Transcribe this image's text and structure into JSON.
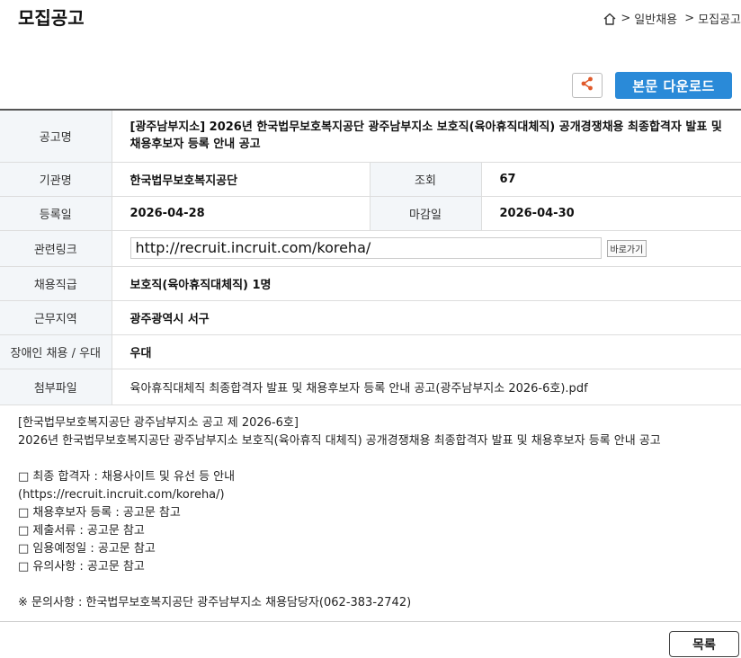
{
  "header": {
    "title": "모집공고",
    "breadcrumb": [
      "일반채용",
      "모집공고"
    ]
  },
  "toolbar": {
    "share_icon": "share-icon",
    "download_label": "본문 다운로드",
    "accent": "#2a8ad8"
  },
  "fields": {
    "notice_label": "공고명",
    "notice_value": "[광주남부지소] 2026년 한국법무보호복지공단 광주남부지소 보호직(육아휴직대체직) 공개경쟁채용 최종합격자 발표 및 채용후보자 등록 안내 공고",
    "org_label": "기관명",
    "org_value": "한국법무보호복지공단",
    "views_label": "조회",
    "views_value": "67",
    "reg_label": "등록일",
    "reg_value": "2026-04-28",
    "deadline_label": "마감일",
    "deadline_value": "2026-04-30",
    "link_label": "관련링크",
    "link_value": "http://recruit.incruit.com/koreha/",
    "link_button": "바로가기",
    "position_label": "채용직급",
    "position_value": "보호직(육아휴직대체직) 1명",
    "location_label": "근무지역",
    "location_value": "광주광역시 서구",
    "disability_label": "장애인 채용 / 우대",
    "disability_value": "우대",
    "attach_label": "첨부파일",
    "attach_value": "육아휴직대체직 최종합격자 발표 및 채용후보자 등록 안내 공고(광주남부지소 2026-6호).pdf"
  },
  "body": {
    "line1": "[한국법무보호복지공단 광주남부지소 공고 제 2026-6호]",
    "line2": "2026년 한국법무보호복지공단 광주남부지소 보호직(육아휴직 대체직) 공개경쟁채용 최종합격자 발표 및 채용후보자 등록 안내 공고",
    "item1": "□ 최종 합격자 : 채용사이트 및 유선 등 안내",
    "item1b": "(https://recruit.incruit.com/koreha/)",
    "item2": "□ 채용후보자 등록 : 공고문 참고",
    "item3": "□ 제출서류 : 공고문 참고",
    "item4": "□ 임용예정일 : 공고문 참고",
    "item5": "□ 유의사항 : 공고문 참고",
    "contact": "※ 문의사항 : 한국법무보호복지공단 광주남부지소 채용담당자(062-383-2742)"
  },
  "footer": {
    "list_label": "목록"
  }
}
